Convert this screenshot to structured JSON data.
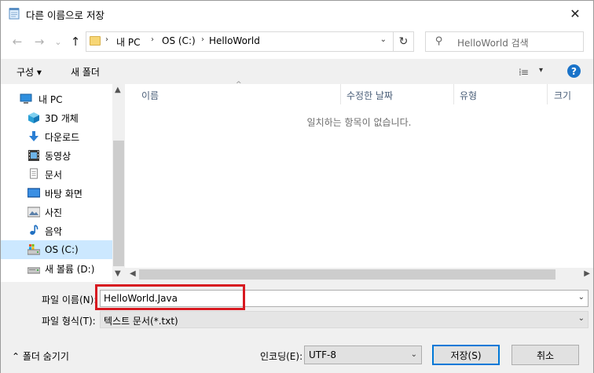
{
  "window": {
    "title": "다른 이름으로 저장",
    "close_glyph": "✕"
  },
  "nav": {
    "back_glyph": "←",
    "forward_glyph": "→",
    "recent_glyph": "⌄",
    "up_glyph": "↑",
    "breadcrumb": [
      "내 PC",
      "OS (C:)",
      "HelloWorld"
    ],
    "chevron_glyph": "›",
    "dropdown_glyph": "⌄",
    "refresh_glyph": "↻",
    "search_placeholder": "HelloWorld 검색",
    "search_glyph": "⚲"
  },
  "toolbar": {
    "organize_label": "구성 ▾",
    "new_folder_label": "새 폴더",
    "view_glyph": "⁞≡",
    "view_caret": "▾",
    "help_glyph": "?"
  },
  "sidebar": {
    "items": [
      {
        "label": "내 PC",
        "icon": "pc-icon"
      },
      {
        "label": "3D 개체",
        "icon": "cube-icon"
      },
      {
        "label": "다운로드",
        "icon": "download-icon"
      },
      {
        "label": "동영상",
        "icon": "video-icon"
      },
      {
        "label": "문서",
        "icon": "document-icon"
      },
      {
        "label": "바탕 화면",
        "icon": "desktop-icon"
      },
      {
        "label": "사진",
        "icon": "picture-icon"
      },
      {
        "label": "음악",
        "icon": "music-icon"
      },
      {
        "label": "OS (C:)",
        "icon": "drive-icon"
      },
      {
        "label": "새 볼륨 (D:)",
        "icon": "drive-icon"
      }
    ],
    "selected_index": 8
  },
  "file_list": {
    "columns": [
      "이름",
      "수정한 날짜",
      "유형",
      "크기"
    ],
    "sort_glyph": "^",
    "empty_message": "일치하는 항목이 없습니다."
  },
  "form": {
    "filename_label": "파일 이름(N):",
    "filename_value": "HelloWorld.Java",
    "filetype_label": "파일 형식(T):",
    "filetype_value": "텍스트 문서(*.txt)",
    "caret_glyph": "⌄"
  },
  "footer": {
    "hide_folders_label": "⌃ 폴더 숨기기",
    "encoding_label": "인코딩(E):",
    "encoding_value": "UTF-8",
    "save_label": "저장(S)",
    "cancel_label": "취소"
  },
  "colors": {
    "highlight_border": "#d71920",
    "selection": "#cce8ff",
    "accent": "#0078d7"
  }
}
